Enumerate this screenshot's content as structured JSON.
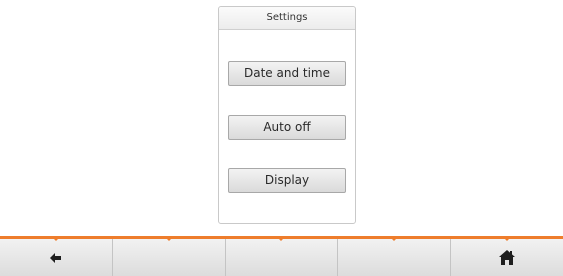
{
  "settings_panel": {
    "title": "Settings",
    "items": [
      {
        "label": "Date and time"
      },
      {
        "label": "Auto off"
      },
      {
        "label": "Display"
      }
    ]
  },
  "bottom_bar": {
    "accent_color": "#ee7d2c",
    "buttons": [
      {
        "icon": "back-arrow-icon"
      },
      {
        "icon": ""
      },
      {
        "icon": ""
      },
      {
        "icon": ""
      },
      {
        "icon": "home-icon"
      }
    ]
  }
}
